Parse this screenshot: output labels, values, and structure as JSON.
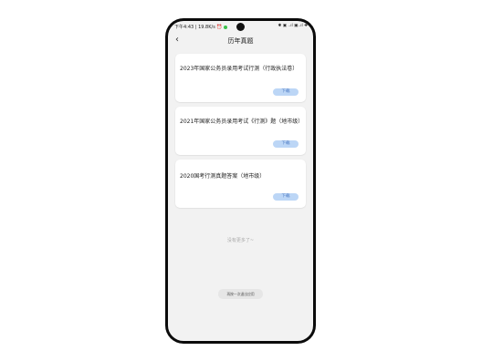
{
  "status_bar": {
    "time": "下午4:43 | 19.8K/s ⏰",
    "right_indicators": "✱ ▣ ..ıl ▣..ıl ✚"
  },
  "header": {
    "back_icon": "back-arrow-icon",
    "title": "历年真题"
  },
  "papers": [
    {
      "title": "2023年国家公务员录用考试行测（行政执法卷）",
      "button": "下载"
    },
    {
      "title": "2021年国家公务员录用考试《行测》题（地市级）",
      "button": "下载"
    },
    {
      "title": "2020国考行测真题答案（地市级）",
      "button": "下载"
    }
  ],
  "footer": {
    "no_more": "没有更多了~"
  },
  "toast": {
    "text": "再按一次退出应用"
  },
  "colors": {
    "background": "#f2f2f2",
    "card": "#ffffff",
    "button_bg": "#bcd6f6",
    "button_text": "#4a78c2"
  }
}
